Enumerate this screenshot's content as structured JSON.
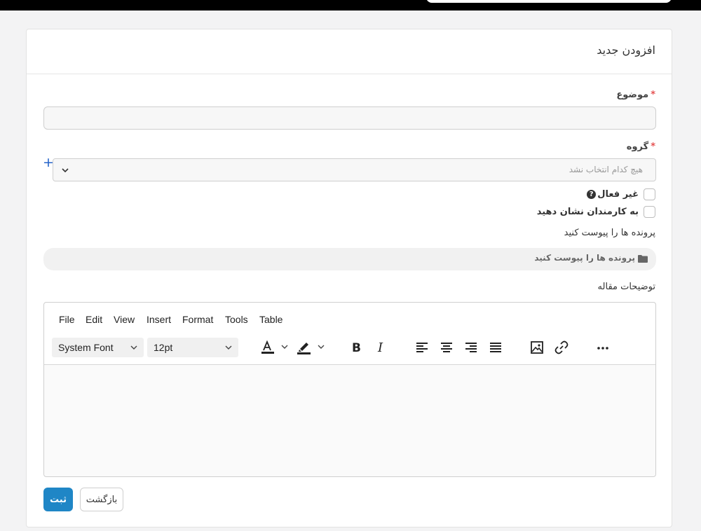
{
  "card": {
    "title": "افزودن جدید"
  },
  "subject": {
    "label": "موضوع",
    "required_mark": "*",
    "value": ""
  },
  "group": {
    "label": "گروه",
    "required_mark": "*",
    "placeholder": "هیچ کدام انتخاب نشد",
    "add_symbol": "+"
  },
  "checks": {
    "inactive_label": "غیر فعال",
    "help_symbol": "?",
    "show_staff_label": "به کارمندان نشان دهید"
  },
  "attachments": {
    "label": "پرونده ها را پیوست کنید",
    "button_text": "پرونده ها را پیوست کنید"
  },
  "description": {
    "label": "توضیحات مقاله"
  },
  "editor": {
    "menu": [
      "File",
      "Edit",
      "View",
      "Insert",
      "Format",
      "Tools",
      "Table"
    ],
    "font_family": "System Font",
    "font_size": "12pt"
  },
  "actions": {
    "submit": "ثبت",
    "back": "بازگشت"
  },
  "colors": {
    "primary": "#1f86c6",
    "required": "#e55353",
    "add_icon": "#2563c8"
  }
}
